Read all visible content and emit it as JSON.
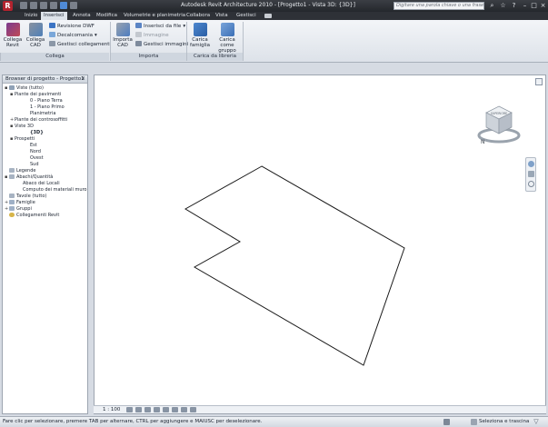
{
  "app": {
    "logo": "R",
    "title": "Autodesk Revit Architecture 2010 - [Progetto1 - Vista 3D: {3D}]"
  },
  "search": {
    "placeholder": "Digitare una parola chiave o una frase"
  },
  "tabs": [
    {
      "label": "Inizio"
    },
    {
      "label": "Inserisci"
    },
    {
      "label": "Annota"
    },
    {
      "label": "Modifica"
    },
    {
      "label": "Volumetrie e planimetria"
    },
    {
      "label": "Collabora"
    },
    {
      "label": "Vista"
    },
    {
      "label": "Gestisci"
    }
  ],
  "ribbon": {
    "collega": {
      "title": "Collega",
      "collega_revit": "Collega Revit",
      "collega_cad": "Collega CAD",
      "revisione_dwf": "Revisione DWF",
      "decalcomania": "Decalcomania",
      "gestisci_collegamenti": "Gestisci collegamenti"
    },
    "importa": {
      "title": "Importa",
      "importa_cad": "Importa CAD",
      "inserisci_da_file": "Inserisci da file",
      "immagine": "Immagine",
      "gestisci_immagini": "Gestisci immagini"
    },
    "libreria": {
      "title": "Carica da libreria",
      "carica_famiglia": "Carica famiglia",
      "carica_come_gruppo": "Carica come gruppo"
    }
  },
  "browser": {
    "title": "Browser di progetto - Progetto1",
    "nodes": [
      {
        "label": "Viste (tutto)",
        "toggle": "▪"
      },
      {
        "label": "Piante dei pavimenti",
        "toggle": "▪"
      },
      {
        "label": "0 - Piano Terra",
        "toggle": ""
      },
      {
        "label": "1 - Piano Primo",
        "toggle": ""
      },
      {
        "label": "Planimetria",
        "toggle": ""
      },
      {
        "label": "Piante dei controsoffitti",
        "toggle": "+"
      },
      {
        "label": "Viste 3D",
        "toggle": "▪"
      },
      {
        "label": "{3D}",
        "toggle": ""
      },
      {
        "label": "Prospetti",
        "toggle": "▪"
      },
      {
        "label": "Est",
        "toggle": ""
      },
      {
        "label": "Nord",
        "toggle": ""
      },
      {
        "label": "Ovest",
        "toggle": ""
      },
      {
        "label": "Sud",
        "toggle": ""
      },
      {
        "label": "Legende",
        "toggle": ""
      },
      {
        "label": "Abachi/Quantità",
        "toggle": "▪"
      },
      {
        "label": "Abaco dei Locali",
        "toggle": ""
      },
      {
        "label": "Computo dei materiali muro",
        "toggle": ""
      },
      {
        "label": "Tavole (tutto)",
        "toggle": ""
      },
      {
        "label": "Famiglie",
        "toggle": "+"
      },
      {
        "label": "Gruppi",
        "toggle": "+"
      },
      {
        "label": "Collegamenti Revit",
        "toggle": ""
      }
    ]
  },
  "viewcube": {
    "face": "SUPERIORE",
    "compass": "N"
  },
  "viewbar": {
    "scale": "1 : 100"
  },
  "status": {
    "message": "Fare clic per selezionare, premere TAB per alternare, CTRL per aggiungere e MAIUSC per deselezionare.",
    "selection": "Seleziona e trascina"
  },
  "colors": {
    "titlebar": "#2c2f35",
    "ribbon": "#e7ebf0",
    "accent": "#2f6db5",
    "brand_red": "#b2232e"
  }
}
